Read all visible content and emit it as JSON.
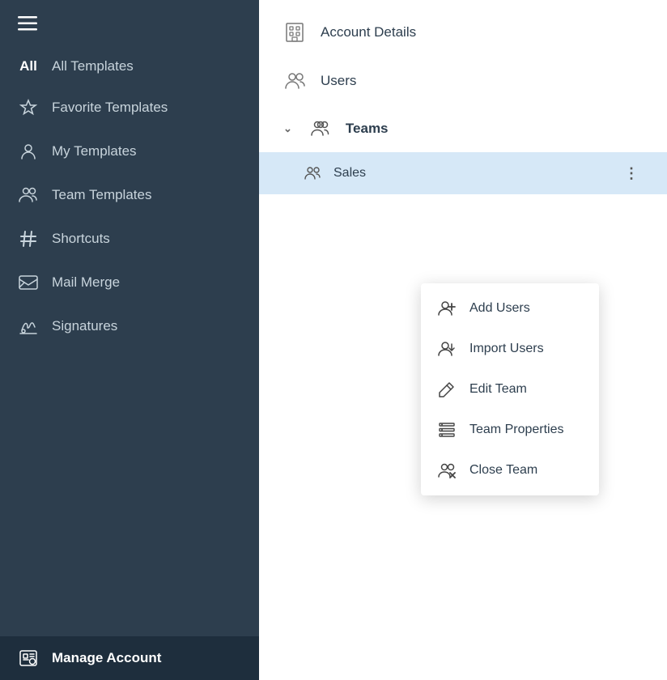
{
  "sidebar": {
    "items": [
      {
        "id": "all-templates",
        "label": "All Templates",
        "icon": "all"
      },
      {
        "id": "favorite-templates",
        "label": "Favorite Templates",
        "icon": "star"
      },
      {
        "id": "my-templates",
        "label": "My Templates",
        "icon": "person"
      },
      {
        "id": "team-templates",
        "label": "Team Templates",
        "icon": "team"
      },
      {
        "id": "shortcuts",
        "label": "Shortcuts",
        "icon": "hash"
      },
      {
        "id": "mail-merge",
        "label": "Mail Merge",
        "icon": "mail"
      },
      {
        "id": "signatures",
        "label": "Signatures",
        "icon": "pen"
      },
      {
        "id": "manage-account",
        "label": "Manage Account",
        "icon": "settings"
      }
    ]
  },
  "account": {
    "items": [
      {
        "id": "account-details",
        "label": "Account Details",
        "icon": "building"
      },
      {
        "id": "users",
        "label": "Users",
        "icon": "users"
      },
      {
        "id": "teams",
        "label": "Teams",
        "icon": "teams",
        "expanded": true
      }
    ],
    "teams_sub": [
      {
        "id": "sales",
        "label": "Sales",
        "selected": true
      }
    ]
  },
  "context_menu": {
    "items": [
      {
        "id": "add-users",
        "label": "Add Users",
        "icon": "add-person"
      },
      {
        "id": "import-users",
        "label": "Import Users",
        "icon": "import-person"
      },
      {
        "id": "edit-team",
        "label": "Edit Team",
        "icon": "pencil"
      },
      {
        "id": "team-properties",
        "label": "Team Properties",
        "icon": "list"
      },
      {
        "id": "close-team",
        "label": "Close Team",
        "icon": "close-team"
      }
    ]
  }
}
